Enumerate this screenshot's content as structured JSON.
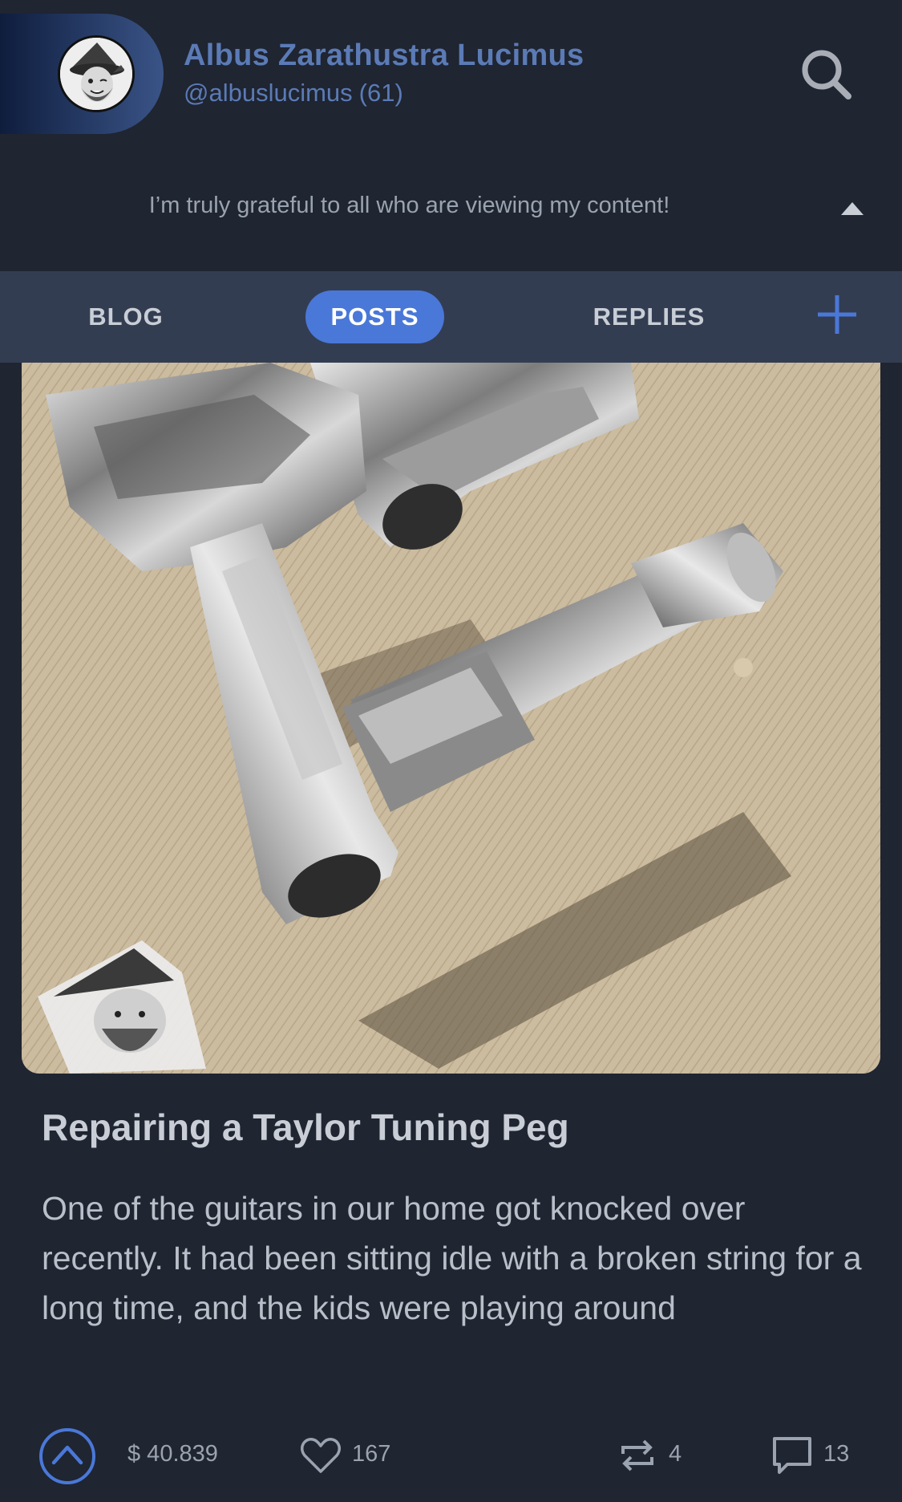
{
  "profile": {
    "name": "Albus Zarathustra Lucimus",
    "handle": "@albuslucimus",
    "reputation": "(61)",
    "bio": "I’m truly grateful to all who are viewing my content!"
  },
  "tabs": [
    {
      "label": "BLOG",
      "active": false
    },
    {
      "label": "POSTS",
      "active": true
    },
    {
      "label": "REPLIES",
      "active": false
    }
  ],
  "post": {
    "title": "Repairing a Taylor Tuning Peg",
    "excerpt": "One of the guitars in our home got knocked over recently. It had been sitting idle with a broken string for a long time, and the kids were playing around",
    "payout": "$ 40.839",
    "likes": "167",
    "reblogs": "4",
    "comments": "13"
  },
  "colors": {
    "background": "#1f2531",
    "tab_bar": "#333d52",
    "accent": "#4a78d8",
    "name_text": "#5b7bb6"
  },
  "icons": {
    "search": "search-icon",
    "collapse": "caret-up-icon",
    "add": "plus-icon",
    "upvote": "chevron-up-circle-icon",
    "like": "heart-icon",
    "reblog": "repeat-icon",
    "comment": "comment-icon"
  }
}
